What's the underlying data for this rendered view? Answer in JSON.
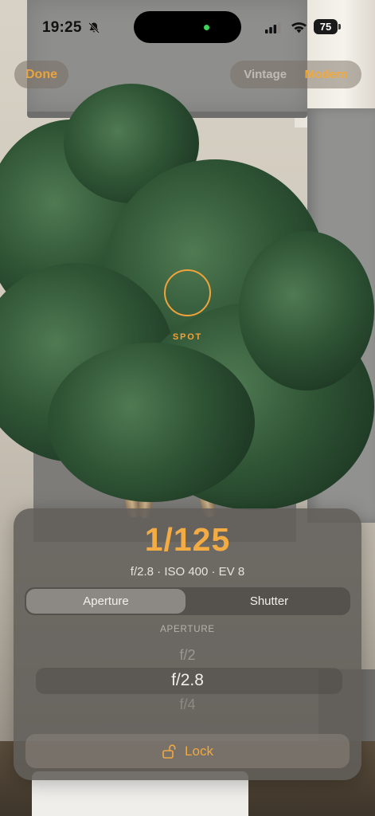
{
  "status_bar": {
    "time": "19:25",
    "battery": "75",
    "icons": [
      "bell-slash-icon",
      "cellular-signal-icon",
      "wifi-icon",
      "battery-icon"
    ]
  },
  "top_controls": {
    "done_label": "Done",
    "style_options": [
      "Vintage",
      "Modern"
    ],
    "style_selected": "Modern"
  },
  "spot": {
    "label": "SPOT"
  },
  "exposure": {
    "shutter_value": "1/125",
    "summary": "f/2.8 · ISO 400 · EV 8",
    "mode_tabs": [
      {
        "label": "Aperture",
        "selected": true
      },
      {
        "label": "Shutter",
        "selected": false
      }
    ],
    "picker": {
      "heading": "APERTURE",
      "options": [
        "f/2",
        "f/2.8",
        "f/4"
      ],
      "selected": "f/2.8"
    },
    "lock_label": "Lock"
  },
  "colors": {
    "accent": "#f0a33a",
    "panel": "#625e5a"
  }
}
